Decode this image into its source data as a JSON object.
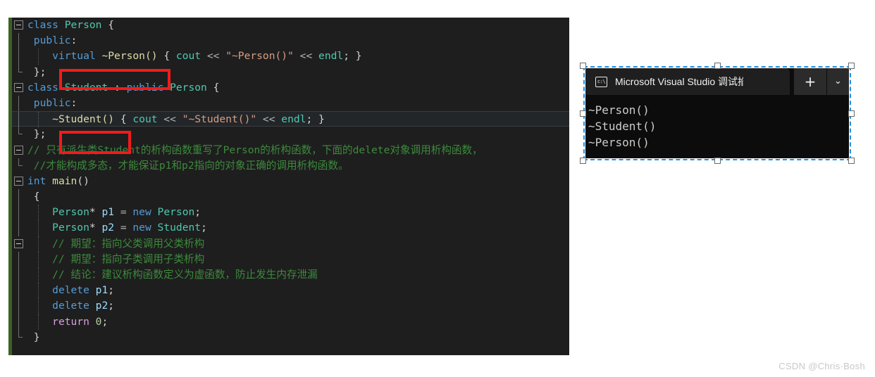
{
  "editor": {
    "name": "visual-studio-code-editor",
    "background": "#1e1e1e",
    "change_bar_color": "#3c6124",
    "current_line": 7,
    "lines": [
      {
        "n": 1,
        "fold": "collapse",
        "guide": "none",
        "indent": false,
        "current": false,
        "tokens": [
          {
            "t": "class ",
            "c": "kw"
          },
          {
            "t": "Person ",
            "c": "typ"
          },
          {
            "t": "{",
            "c": "pun"
          }
        ]
      },
      {
        "n": 2,
        "fold": "none",
        "guide": "line",
        "indent": false,
        "current": false,
        "tokens": [
          {
            "t": " ",
            "c": "pun"
          },
          {
            "t": "public",
            "c": "kw"
          },
          {
            "t": ":",
            "c": "pun"
          }
        ]
      },
      {
        "n": 3,
        "fold": "none",
        "guide": "line",
        "indent": true,
        "current": false,
        "tokens": [
          {
            "t": "    ",
            "c": "pun"
          },
          {
            "t": "virtual",
            "c": "kw"
          },
          {
            "t": " ",
            "c": "pun"
          },
          {
            "t": "~Person()",
            "c": "fn"
          },
          {
            "t": " { ",
            "c": "pun"
          },
          {
            "t": "cout",
            "c": "typ"
          },
          {
            "t": " << ",
            "c": "op"
          },
          {
            "t": "\"~Person()\"",
            "c": "str"
          },
          {
            "t": " << ",
            "c": "op"
          },
          {
            "t": "endl",
            "c": "typ"
          },
          {
            "t": "; }",
            "c": "pun"
          }
        ]
      },
      {
        "n": 4,
        "fold": "none",
        "guide": "end",
        "indent": false,
        "current": false,
        "tokens": [
          {
            "t": " };",
            "c": "pun"
          }
        ]
      },
      {
        "n": 5,
        "fold": "collapse",
        "guide": "none",
        "indent": false,
        "current": false,
        "tokens": [
          {
            "t": "class ",
            "c": "kw"
          },
          {
            "t": "Student ",
            "c": "typ"
          },
          {
            "t": ": ",
            "c": "pun"
          },
          {
            "t": "public ",
            "c": "kw"
          },
          {
            "t": "Person ",
            "c": "typ"
          },
          {
            "t": "{",
            "c": "pun"
          }
        ]
      },
      {
        "n": 6,
        "fold": "none",
        "guide": "line",
        "indent": false,
        "current": false,
        "tokens": [
          {
            "t": " ",
            "c": "pun"
          },
          {
            "t": "public",
            "c": "kw"
          },
          {
            "t": ":",
            "c": "pun"
          }
        ]
      },
      {
        "n": 7,
        "fold": "none",
        "guide": "line",
        "indent": true,
        "current": true,
        "tokens": [
          {
            "t": "    ",
            "c": "pun"
          },
          {
            "t": "~Student()",
            "c": "fn"
          },
          {
            "t": " { ",
            "c": "pun"
          },
          {
            "t": "cout",
            "c": "typ"
          },
          {
            "t": " << ",
            "c": "op"
          },
          {
            "t": "\"~Student()\"",
            "c": "str"
          },
          {
            "t": " << ",
            "c": "op"
          },
          {
            "t": "endl",
            "c": "typ"
          },
          {
            "t": "; }",
            "c": "pun"
          }
        ]
      },
      {
        "n": 8,
        "fold": "none",
        "guide": "end",
        "indent": false,
        "current": false,
        "tokens": [
          {
            "t": " };",
            "c": "pun"
          }
        ]
      },
      {
        "n": 9,
        "fold": "collapse",
        "guide": "none",
        "indent": false,
        "current": false,
        "tokens": [
          {
            "t": "// 只有派生类Student的析构函数重写了Person的析构函数，下面的delete对象调用析构函数，",
            "c": "cmt"
          }
        ]
      },
      {
        "n": 10,
        "fold": "none",
        "guide": "end",
        "indent": false,
        "current": false,
        "tokens": [
          {
            "t": " //才能构成多态，才能保证p1和p2指向的对象正确的调用析构函数。",
            "c": "cmt"
          }
        ]
      },
      {
        "n": 11,
        "fold": "collapse",
        "guide": "none",
        "indent": false,
        "current": false,
        "tokens": [
          {
            "t": "int ",
            "c": "kw"
          },
          {
            "t": "main",
            "c": "fn"
          },
          {
            "t": "()",
            "c": "pun"
          }
        ]
      },
      {
        "n": 12,
        "fold": "none",
        "guide": "line",
        "indent": false,
        "current": false,
        "tokens": [
          {
            "t": " {",
            "c": "pun"
          }
        ]
      },
      {
        "n": 13,
        "fold": "none",
        "guide": "line",
        "indent": true,
        "current": false,
        "tokens": [
          {
            "t": "    ",
            "c": "pun"
          },
          {
            "t": "Person",
            "c": "typ"
          },
          {
            "t": "* ",
            "c": "pun"
          },
          {
            "t": "p1",
            "c": "var"
          },
          {
            "t": " = ",
            "c": "op"
          },
          {
            "t": "new ",
            "c": "kw"
          },
          {
            "t": "Person",
            "c": "typ"
          },
          {
            "t": ";",
            "c": "pun"
          }
        ]
      },
      {
        "n": 14,
        "fold": "none",
        "guide": "line",
        "indent": true,
        "current": false,
        "tokens": [
          {
            "t": "    ",
            "c": "pun"
          },
          {
            "t": "Person",
            "c": "typ"
          },
          {
            "t": "* ",
            "c": "pun"
          },
          {
            "t": "p2",
            "c": "var"
          },
          {
            "t": " = ",
            "c": "op"
          },
          {
            "t": "new ",
            "c": "kw"
          },
          {
            "t": "Student",
            "c": "typ"
          },
          {
            "t": ";",
            "c": "pun"
          }
        ]
      },
      {
        "n": 15,
        "fold": "collapse",
        "guide": "none",
        "indent": true,
        "current": false,
        "tokens": [
          {
            "t": "    // 期望：指向父类调用父类析构",
            "c": "cmt"
          }
        ]
      },
      {
        "n": 16,
        "fold": "none",
        "guide": "line",
        "indent": true,
        "current": false,
        "tokens": [
          {
            "t": "    // 期望：指向子类调用子类析构",
            "c": "cmt"
          }
        ]
      },
      {
        "n": 17,
        "fold": "none",
        "guide": "line",
        "indent": true,
        "current": false,
        "tokens": [
          {
            "t": "    // 结论：建议析构函数定义为虚函数，防止发生内存泄漏",
            "c": "cmt"
          }
        ]
      },
      {
        "n": 18,
        "fold": "none",
        "guide": "line",
        "indent": true,
        "current": false,
        "tokens": [
          {
            "t": "    ",
            "c": "pun"
          },
          {
            "t": "delete ",
            "c": "kw"
          },
          {
            "t": "p1",
            "c": "var"
          },
          {
            "t": ";",
            "c": "pun"
          }
        ]
      },
      {
        "n": 19,
        "fold": "none",
        "guide": "line",
        "indent": true,
        "current": false,
        "tokens": [
          {
            "t": "    ",
            "c": "pun"
          },
          {
            "t": "delete ",
            "c": "kw"
          },
          {
            "t": "p2",
            "c": "var"
          },
          {
            "t": ";",
            "c": "pun"
          }
        ]
      },
      {
        "n": 20,
        "fold": "none",
        "guide": "line",
        "indent": true,
        "current": false,
        "tokens": [
          {
            "t": "    ",
            "c": "pun"
          },
          {
            "t": "return ",
            "c": "kwp"
          },
          {
            "t": "0",
            "c": "num"
          },
          {
            "t": ";",
            "c": "pun"
          }
        ]
      },
      {
        "n": 21,
        "fold": "none",
        "guide": "end",
        "indent": false,
        "current": false,
        "tokens": [
          {
            "t": " }",
            "c": "pun"
          }
        ]
      }
    ],
    "annotations": [
      {
        "id": "redbox-person",
        "label": "virtual ~Person()",
        "color": "#f21b1b"
      },
      {
        "id": "redbox-student",
        "label": "~Student()",
        "color": "#f21b1b"
      }
    ]
  },
  "console": {
    "name": "visual-studio-debug-console",
    "tab_icon": "console-window-icon",
    "tab_icon_glyph": "c:\\",
    "tab_title": "Microsoft Visual Studio 调试掐",
    "close_label": "✕",
    "new_tab_label": "+",
    "dropdown_label": "⌄",
    "background": "#0c0c0c",
    "output_lines": [
      "~Person()",
      "~Student()",
      "~Person()"
    ],
    "selection_border_color": "#1f8fe0"
  },
  "watermark": {
    "text": "CSDN @Chris·Bosh"
  }
}
